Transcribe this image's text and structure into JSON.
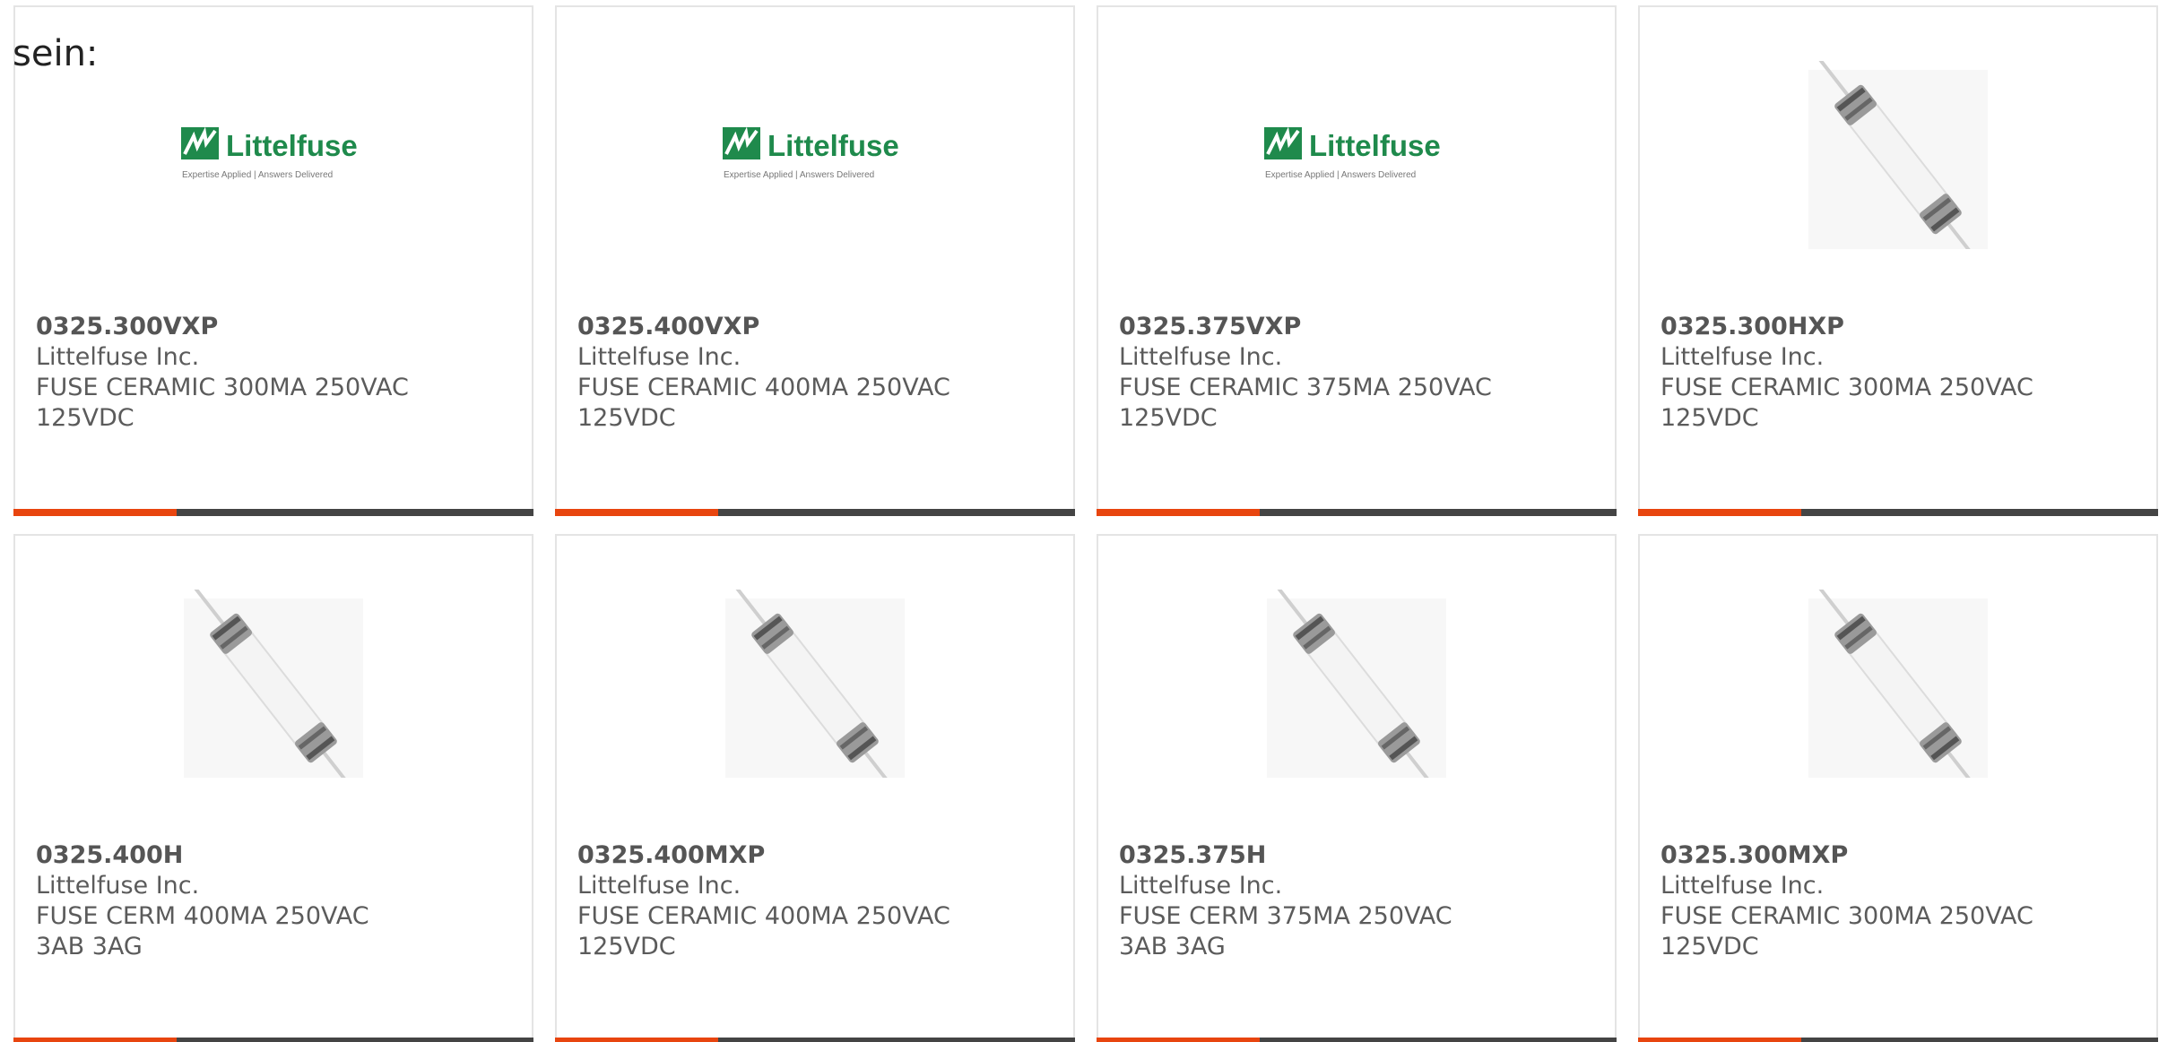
{
  "intro_text": "sein:",
  "colors": {
    "accent": "#e8450f",
    "bar_dark": "#444444",
    "logo_green": "#1f8a4c"
  },
  "logo": {
    "name": "Littelfuse",
    "tagline": "Expertise Applied | Answers Delivered"
  },
  "products": [
    {
      "part": "0325.300VXP",
      "mfr": "Littelfuse Inc.",
      "desc": "FUSE CERAMIC 300MA 250VAC 125VDC",
      "image": "littelfuse-logo"
    },
    {
      "part": "0325.400VXP",
      "mfr": "Littelfuse Inc.",
      "desc": "FUSE CERAMIC 400MA 250VAC 125VDC",
      "image": "littelfuse-logo"
    },
    {
      "part": "0325.375VXP",
      "mfr": "Littelfuse Inc.",
      "desc": "FUSE CERAMIC 375MA 250VAC 125VDC",
      "image": "littelfuse-logo"
    },
    {
      "part": "0325.300HXP",
      "mfr": "Littelfuse Inc.",
      "desc": "FUSE CERAMIC 300MA 250VAC 125VDC",
      "image": "fuse-photo"
    },
    {
      "part": "0325.400H",
      "mfr": "Littelfuse Inc.",
      "desc": "FUSE CERM 400MA 250VAC 3AB 3AG",
      "image": "fuse-photo"
    },
    {
      "part": "0325.400MXP",
      "mfr": "Littelfuse Inc.",
      "desc": "FUSE CERAMIC 400MA 250VAC 125VDC",
      "image": "fuse-photo"
    },
    {
      "part": "0325.375H",
      "mfr": "Littelfuse Inc.",
      "desc": "FUSE CERM 375MA 250VAC 3AB 3AG",
      "image": "fuse-photo"
    },
    {
      "part": "0325.300MXP",
      "mfr": "Littelfuse Inc.",
      "desc": "FUSE CERAMIC 300MA 250VAC 125VDC",
      "image": "fuse-photo"
    }
  ]
}
